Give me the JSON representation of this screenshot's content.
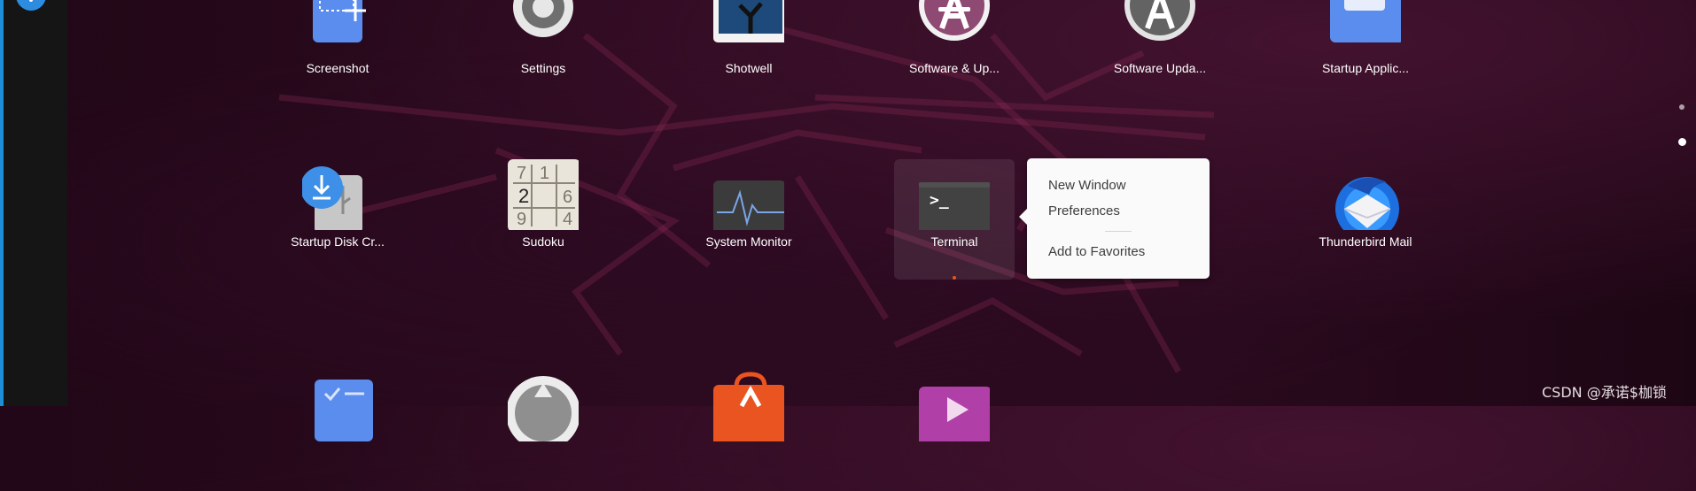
{
  "apps": {
    "row1": [
      {
        "label": "Screenshot",
        "icon": "screenshot-icon"
      },
      {
        "label": "Settings",
        "icon": "gear-icon"
      },
      {
        "label": "Shotwell",
        "icon": "shotwell-icon"
      },
      {
        "label": "Software & Up...",
        "icon": "software-properties-icon"
      },
      {
        "label": "Software Upda...",
        "icon": "software-updater-icon"
      },
      {
        "label": "Startup Applic...",
        "icon": "startup-applications-icon"
      }
    ],
    "row2": [
      {
        "label": "Startup Disk Cr...",
        "icon": "usb-creator-icon"
      },
      {
        "label": "Sudoku",
        "icon": "sudoku-icon"
      },
      {
        "label": "System Monitor",
        "icon": "system-monitor-icon"
      },
      {
        "label": "Terminal",
        "icon": "terminal-icon",
        "running": true
      },
      {
        "label": "Thunderbird Mail",
        "icon": "thunderbird-icon"
      }
    ],
    "row3": [
      {
        "icon": "todo-icon"
      },
      {
        "icon": "disk-icon"
      },
      {
        "icon": "software-store-icon"
      },
      {
        "icon": "videos-icon"
      }
    ]
  },
  "sudoku_digits": [
    "7",
    "1",
    "2",
    "6",
    "9",
    "4"
  ],
  "terminal_prompt": ">_",
  "context_menu": {
    "items": [
      "New Window",
      "Preferences",
      "Add to Favorites"
    ]
  },
  "pagination": {
    "pages": 2,
    "current": 2
  },
  "watermark": "CSDN @承诺$枷锁",
  "colors": {
    "background": "#2a0a1e",
    "dock": "#151515",
    "dock_edge": "#1d8fd8",
    "running_indicator": "#e95420",
    "menu_bg": "#fafafa"
  }
}
